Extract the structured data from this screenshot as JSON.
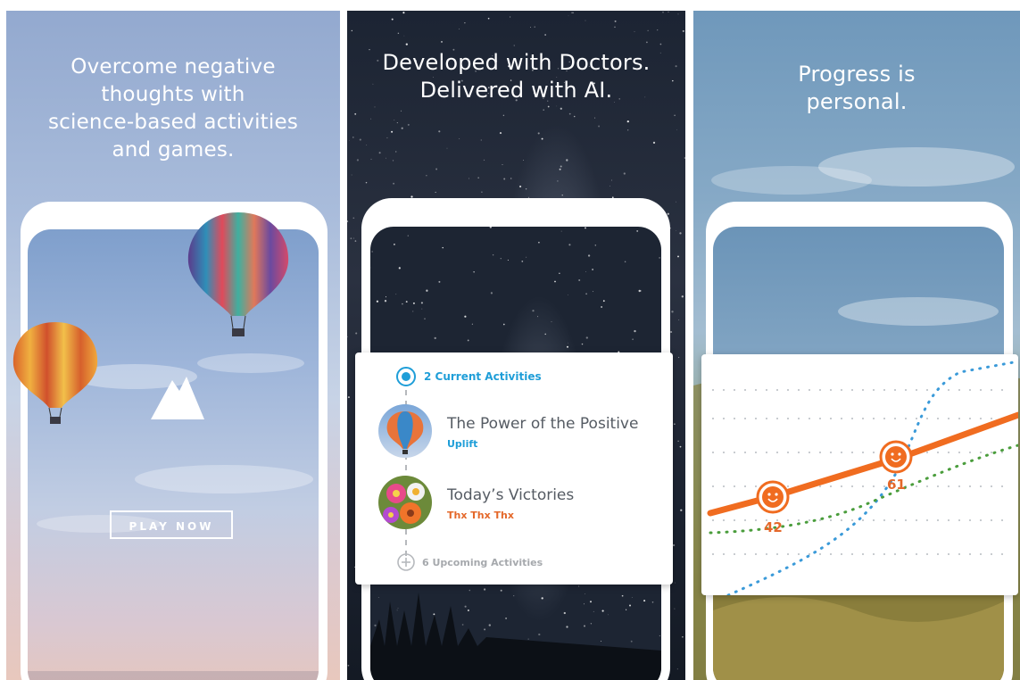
{
  "panels": [
    {
      "headline": "Overcome negative\nthoughts with\nscience-based activities\nand games.",
      "button_label": "PLAY NOW",
      "icon": "mountain-icon"
    },
    {
      "headline": "Developed with Doctors.\nDelivered with AI.",
      "current_label": "2 Current Activities",
      "activities": [
        {
          "title": "The Power of the Positive",
          "subtitle": "Uplift",
          "subtitle_color": "#1f9ed8",
          "icon": "hot-air-balloon-icon"
        },
        {
          "title": "Today’s Victories",
          "subtitle": "Thx Thx Thx",
          "subtitle_color": "#e4682a",
          "icon": "flowers-icon"
        }
      ],
      "upcoming_label": "6 Upcoming Activities"
    },
    {
      "headline": "Progress is\npersonal.",
      "scores": [
        "42",
        "61"
      ],
      "colors": {
        "orange": "#f06c20",
        "blue": "#3a9ad9",
        "green": "#4a9d3c",
        "grid": "#c8ccd0"
      }
    }
  ]
}
